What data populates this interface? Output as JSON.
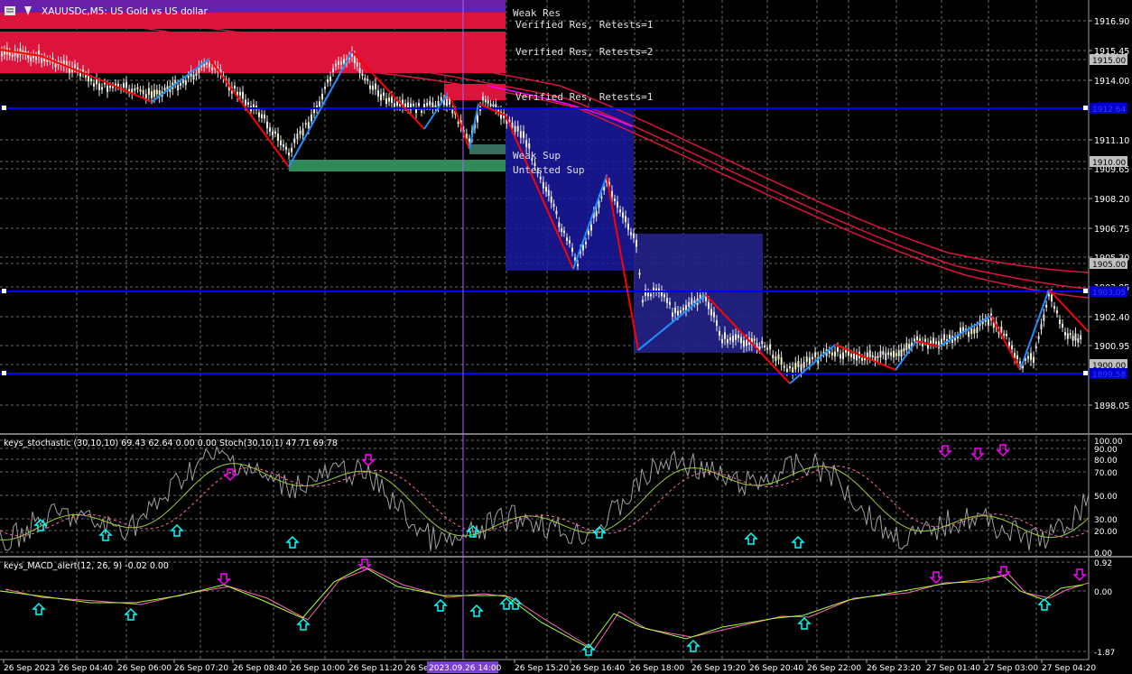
{
  "header": {
    "title": "XAUUSDc,M5: US Gold vs US dollar"
  },
  "colors": {
    "background": "#000000",
    "grid": "#7a7a7a",
    "resistance_zone": "#dc143c",
    "support_zone": "#2e8b57",
    "demand_box": "#1a1aa0",
    "zigzag_down": "#ff0000",
    "zigzag_up": "#1e90ff",
    "level_line": "#0000ff",
    "ma_line": "#dc143c",
    "ma_magenta": "#ff00ff",
    "stoch_main": "#c8c8c8",
    "stoch_signal": "#9acd32",
    "arrow_up": "#00ffff",
    "arrow_down": "#ff00ff",
    "macd_main": "#adff2f",
    "macd_signal": "#ff69b4"
  },
  "zone_labels": {
    "weak_res": "Weak Res",
    "verified_res_1": "Verified Res, Retests=1",
    "verified_res_2": "Verified Res, Retests=2",
    "verified_res_3": "Verified Res, Retests=1",
    "weak_sup": "Weak Sup",
    "untested_sup": "Untested Sup"
  },
  "price_axis": {
    "ticks": [
      "1916.90",
      "1915.45",
      "1914.00",
      "1911.10",
      "1909.65",
      "1908.20",
      "1906.75",
      "1905.30",
      "1903.85",
      "1902.40",
      "1900.95",
      "1898.05"
    ],
    "tags": [
      "1915.00",
      "1912.64",
      "1910.00",
      "1905.00",
      "1903.05",
      "1900.00",
      "1899.58"
    ]
  },
  "stoch": {
    "header": "keys_stochastic (30,10,10) 69.43 62.64 0.00 0.00 Stoch(30,10,1) 47.71 69.78",
    "levels": [
      "100.00",
      "90.00",
      "80.00",
      "70.00",
      "50.00",
      "30.00",
      "20.00",
      "0.00"
    ]
  },
  "macd": {
    "header": "keys_MACD_alert(12, 26, 9) -0.02 0.00",
    "levels": [
      "0.92",
      "0.00",
      "-1.87"
    ]
  },
  "time_axis": {
    "labels": [
      "26 Sep 2023",
      "26 Sep 04:40",
      "26 Sep 06:00",
      "26 Sep 07:20",
      "26 Sep 08:40",
      "26 Sep 10:00",
      "26 Sep 11:20",
      "26 Sep 14:00",
      "26 Sep 15:20",
      "26 Sep 16:40",
      "26 Sep 18:00",
      "26 Sep 19:20",
      "26 Sep 20:40",
      "26 Sep 22:00",
      "26 Sep 23:20",
      "27 Sep 01:40",
      "27 Sep 03:00",
      "27 Sep 04:20"
    ],
    "crosshair": "2023.09.26 14:00"
  }
}
